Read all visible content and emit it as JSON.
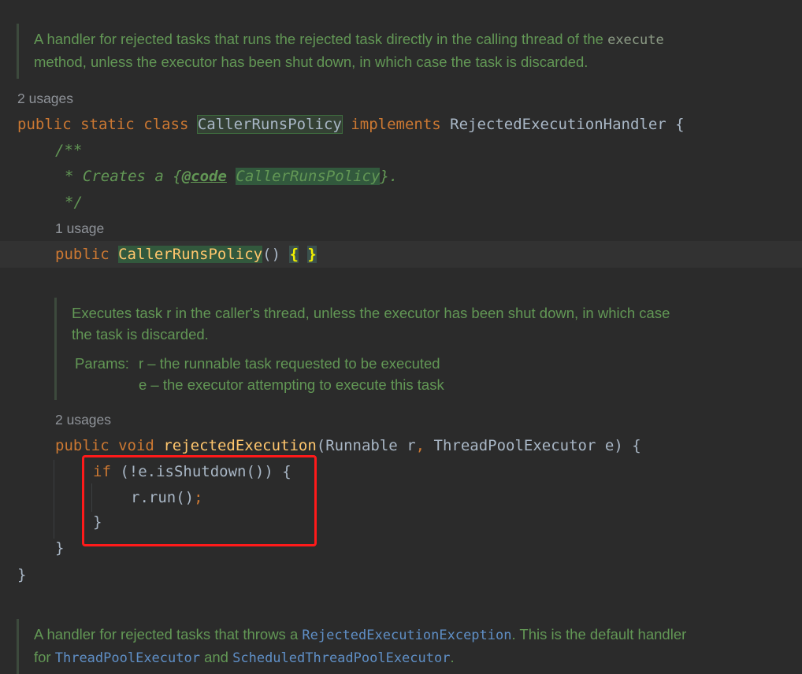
{
  "doc1": {
    "line1_text": "A handler for rejected tasks that runs the rejected task directly in the calling thread of the ",
    "line1_code": "execute",
    "line2": "method, unless the executor has been shut down, in which case the task is discarded."
  },
  "usage_class": "2 usages",
  "class_decl": {
    "kw1": "public",
    "kw2": "static",
    "kw3": "class",
    "name": "CallerRunsPolicy",
    "kw4": "implements",
    "iface": "RejectedExecutionHandler",
    "brace": "{"
  },
  "comment": {
    "open": "/**",
    "star": "* Creates a ",
    "tag_open": "{",
    "tag": "@code",
    "name": "CallerRunsPolicy",
    "tag_close": "}.",
    "close": "*/"
  },
  "usage_ctor": "1 usage",
  "ctor": {
    "kw": "public",
    "name": "CallerRunsPolicy",
    "parens": "()",
    "open": "{",
    "close": "}"
  },
  "doc2": {
    "line1": "Executes task r in the caller's thread, unless the executor has been shut down, in which case",
    "line2": "the task is discarded.",
    "params_label": "Params:",
    "param1": "r – the runnable task requested to be executed",
    "param2": "e – the executor attempting to execute this task"
  },
  "usage_method": "2 usages",
  "method": {
    "kw1": "public",
    "kw2": "void",
    "name": "rejectedExecution",
    "open_paren": "(",
    "type1": "Runnable",
    "arg1": " r",
    "comma": ",",
    "type2": " ThreadPoolExecutor",
    "arg2": " e",
    "close": ") {"
  },
  "body": {
    "if_kw": "if",
    "cond": " (!e.isShutdown()) {",
    "run": "r.run()",
    "semi": ";",
    "if_close": "}",
    "method_close": "}",
    "class_close": "}"
  },
  "doc3": {
    "t1": "A handler for rejected tasks that throws a ",
    "c1": "RejectedExecutionException",
    "t2": ". This is the default handler",
    "t3": "for ",
    "c2": "ThreadPoolExecutor",
    "t4": " and ",
    "c3": "ScheduledThreadPoolExecutor",
    "t5": "."
  },
  "colors": {
    "background": "#2b2b2b",
    "keyword": "#cc7832",
    "method": "#ffc66d",
    "doc": "#629755",
    "plain": "#a9b7c6",
    "highlight_box": "#ff1a1a"
  }
}
